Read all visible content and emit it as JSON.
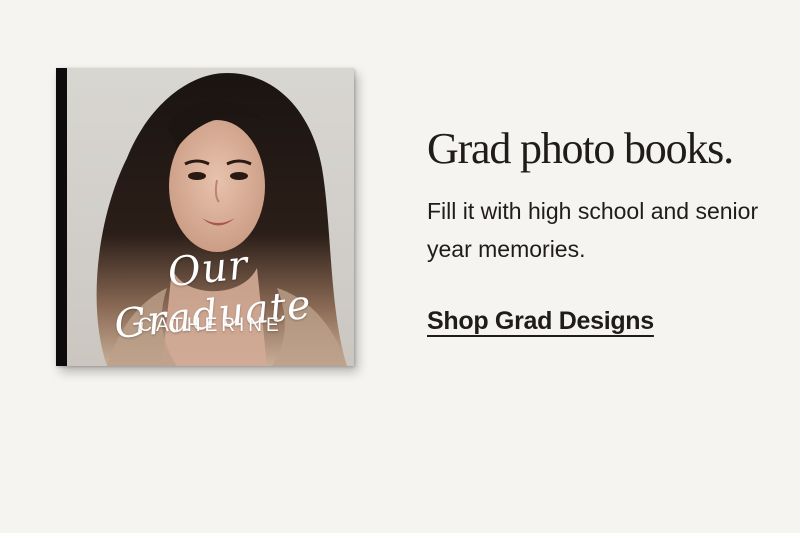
{
  "promo": {
    "headline": "Grad photo books.",
    "subtext": "Fill it with high school and senior year memories.",
    "cta_label": "Shop Grad Designs"
  },
  "book": {
    "cover_script": "Our Graduate",
    "cover_name": "CATHERINE",
    "image_subject": "graduate-portrait-photo"
  },
  "colors": {
    "background": "#f6f4f1",
    "text": "#1f1c1b",
    "spine": "#0d0b0b",
    "cover_text": "#ffffff"
  }
}
